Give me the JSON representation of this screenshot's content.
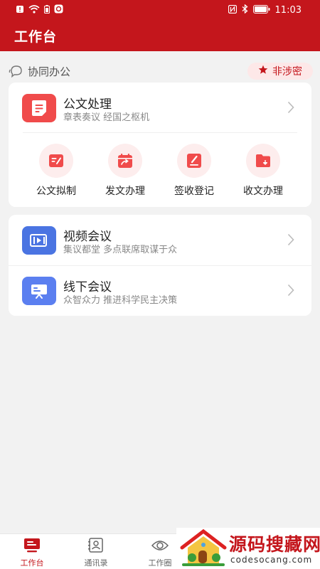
{
  "status_bar": {
    "time": "11:03"
  },
  "app_bar": {
    "title": "工作台"
  },
  "section": {
    "title": "协同办公",
    "badge": "非涉密"
  },
  "document_card": {
    "title": "公文处理",
    "subtitle": "章表奏议 经国之枢机",
    "actions": [
      {
        "label": "公文拟制",
        "icon": "draft-icon"
      },
      {
        "label": "发文办理",
        "icon": "send-calendar-icon"
      },
      {
        "label": "签收登记",
        "icon": "sign-icon"
      },
      {
        "label": "收文办理",
        "icon": "receive-folder-icon"
      }
    ]
  },
  "meetings": [
    {
      "title": "视频会议",
      "subtitle": "集议都堂 多点联席取谋于众",
      "icon": "video-icon",
      "color": "#4a74e2"
    },
    {
      "title": "线下会议",
      "subtitle": "众智众力 推进科学民主决策",
      "icon": "presentation-icon",
      "color": "#5b7ff0"
    }
  ],
  "tab_bar": {
    "tabs": [
      {
        "label": "工作台",
        "active": true
      },
      {
        "label": "通讯录",
        "active": false
      },
      {
        "label": "工作圈",
        "active": false
      }
    ]
  },
  "watermark": {
    "name": "源码搜藏网",
    "domain": "codesocang.com"
  },
  "colors": {
    "brand": "#c4161c",
    "icon_pink": "#f04b4b",
    "bg": "#f2f2f2"
  }
}
